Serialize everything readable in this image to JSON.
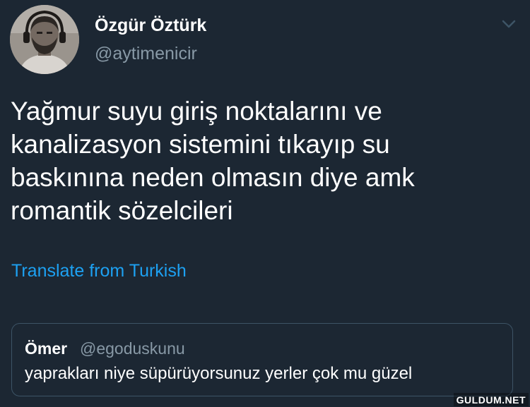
{
  "author": {
    "display_name": "Özgür Öztürk",
    "handle": "@aytimenicir",
    "avatar_icon": "profile-photo"
  },
  "menu_icon": "chevron-down-icon",
  "tweet": {
    "text": "Yağmur suyu giriş noktalarını ve\nkanalizasyon sistemini tıkayıp su\nbaskınına neden olmasın diye amk\nromantik sözelcileri",
    "translate_label": "Translate from Turkish"
  },
  "quoted_tweet": {
    "display_name": "Ömer",
    "handle": "@egoduskunu",
    "text": "yaprakları niye süpürüyorsunuz yerler çok mu güzel"
  },
  "watermark": "GULDUM.NET",
  "colors": {
    "background": "#1c2733",
    "primary_text": "#ffffff",
    "secondary_text": "#8899a6",
    "link": "#1da1f2",
    "card_border": "#3d5466"
  }
}
